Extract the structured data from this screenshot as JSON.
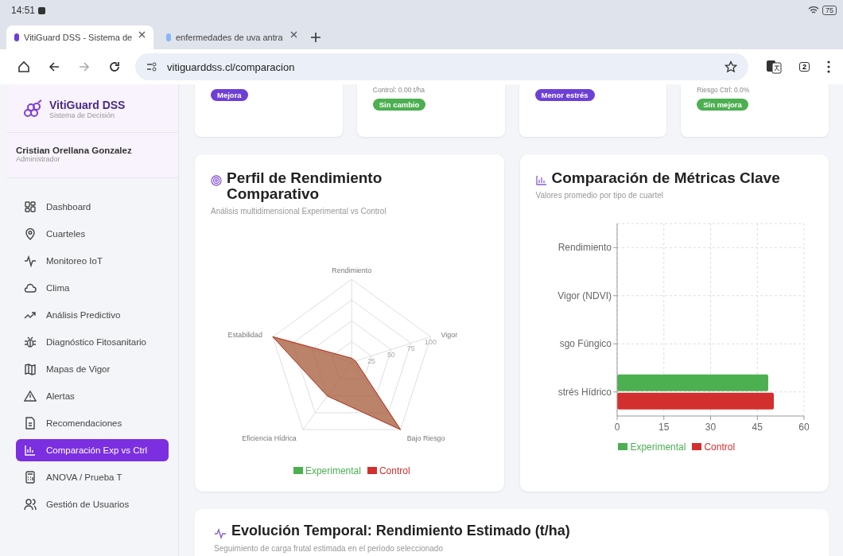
{
  "browser": {
    "time": "14:51",
    "battery": "75",
    "tabs": [
      {
        "title": "VitiGuard DSS - Sistema de",
        "selected": true
      },
      {
        "title": "enfermedades de uva antra",
        "selected": false
      }
    ],
    "url": "vitiguarddss.cl/comparacion",
    "tab_count": "2"
  },
  "sidebar": {
    "brand": "VitiGuard DSS",
    "subtitle": "Sistema de Decisión",
    "user": {
      "name": "Cristian Orellana Gonzalez",
      "role": "Administrador"
    },
    "items": [
      {
        "label": "Dashboard",
        "selected": false
      },
      {
        "label": "Cuarteles",
        "selected": false
      },
      {
        "label": "Monitoreo IoT",
        "selected": false
      },
      {
        "label": "Clima",
        "selected": false
      },
      {
        "label": "Análisis Predictivo",
        "selected": false
      },
      {
        "label": "Diagnóstico Fitosanitario",
        "selected": false
      },
      {
        "label": "Mapas de Vigor",
        "selected": false
      },
      {
        "label": "Alertas",
        "selected": false
      },
      {
        "label": "Recomendaciones",
        "selected": false
      },
      {
        "label": "Comparación Exp vs Ctrl",
        "selected": true
      },
      {
        "label": "ANOVA / Prueba T",
        "selected": false
      },
      {
        "label": "Gestión de Usuarios",
        "selected": false
      }
    ]
  },
  "summary_cards": [
    {
      "badge": {
        "label": "Mejora",
        "color": "#6d3fd6"
      }
    },
    {
      "note": "Control: 0.00 t/ha",
      "badge": {
        "label": "Sin cambio",
        "color": "#4caf50"
      }
    },
    {
      "badge": {
        "label": "Menor estrés",
        "color": "#6d3fd6"
      }
    },
    {
      "note": "Riesgo Ctrl: 0.0%",
      "badge": {
        "label": "Sin mejora",
        "color": "#4caf50"
      }
    }
  ],
  "radar_card": {
    "title": "Perfil de Rendimiento Comparativo",
    "subtitle": "Análisis multidimensional Experimental vs Control",
    "axes": [
      "Rendimiento",
      "Vigor",
      "Bajo Riesgo",
      "Eficiencia Hídrica",
      "Estabilidad"
    ],
    "scale_labels": [
      "25",
      "50",
      "75",
      "100"
    ],
    "legend": [
      {
        "label": "Experimental",
        "color": "#4caf50"
      },
      {
        "label": "Control",
        "color": "#d32f2f"
      }
    ]
  },
  "bar_card": {
    "title": "Comparación de Métricas Clave",
    "subtitle": "Valores promedio por tipo de cuartel",
    "chart_data": {
      "type": "bar",
      "orientation": "horizontal",
      "grid": true,
      "categories": [
        "Rendimiento",
        "Vigor (NDVI)",
        "sgo Fúngico",
        "strés Hídrico"
      ],
      "xticks": [
        0,
        15,
        30,
        45,
        60
      ],
      "xlim": [
        0,
        60
      ],
      "series": [
        {
          "name": "Experimental",
          "color": "#4caf50",
          "values": [
            0,
            0,
            0,
            48.5
          ]
        },
        {
          "name": "Control",
          "color": "#d32f2f",
          "values": [
            0,
            0,
            0,
            50.3
          ]
        }
      ]
    }
  },
  "timeline_card": {
    "title": "Evolución Temporal: Rendimiento Estimado (t/ha)",
    "subtitle": "Seguimiento de carga frutal estimada en el período seleccionado"
  }
}
